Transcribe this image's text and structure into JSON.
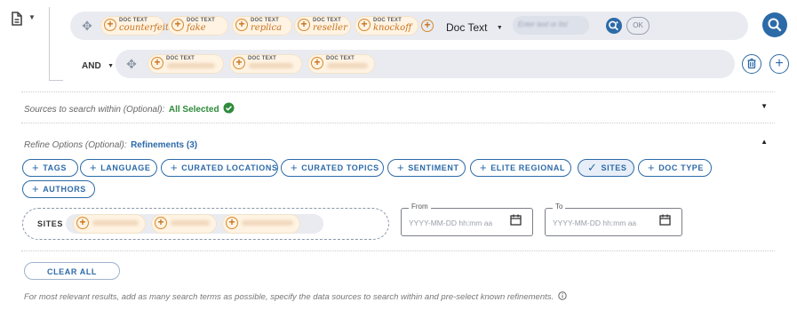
{
  "query_builder": {
    "row1": {
      "chips": [
        {
          "caption": "DOC TEXT",
          "value": "counterfeit"
        },
        {
          "caption": "DOC TEXT",
          "value": "fake"
        },
        {
          "caption": "DOC TEXT",
          "value": "replica"
        },
        {
          "caption": "DOC TEXT",
          "value": "reseller"
        },
        {
          "caption": "DOC TEXT",
          "value": "knockoff"
        }
      ],
      "field_select": "Doc Text",
      "search_placeholder": "Enter text or list",
      "ok_label": "OK"
    },
    "row2": {
      "operator": "AND",
      "chips": [
        {
          "caption": "DOC TEXT"
        },
        {
          "caption": "DOC TEXT"
        },
        {
          "caption": "DOC TEXT"
        }
      ]
    }
  },
  "sources": {
    "label": "Sources to search within (Optional):",
    "value": "All Selected"
  },
  "refine": {
    "label": "Refine Options (Optional):",
    "value": "Refinements (3)",
    "buttons": [
      "TAGS",
      "LANGUAGE",
      "CURATED LOCATIONS",
      "CURATED TOPICS",
      "SENTIMENT",
      "ELITE REGIONAL",
      "SITES",
      "DOC TYPE",
      "AUTHORS"
    ],
    "active": "SITES"
  },
  "sites_filter": {
    "label": "SITES"
  },
  "date_from": {
    "label": "From",
    "placeholder": "YYYY-MM-DD hh:mm aa"
  },
  "date_to": {
    "label": "To",
    "placeholder": "YYYY-MM-DD hh:mm aa"
  },
  "clear_all": "CLEAR ALL",
  "hint": "For most relevant results, add as many search terms as possible, specify the data sources to search within and pre-select known refinements.",
  "colors": {
    "accent": "#2c6aa8",
    "chip_bg": "#fff3e3",
    "chip_icon": "#d8882b",
    "row_bg": "#e9ebf1",
    "success": "#2e8b3a"
  }
}
